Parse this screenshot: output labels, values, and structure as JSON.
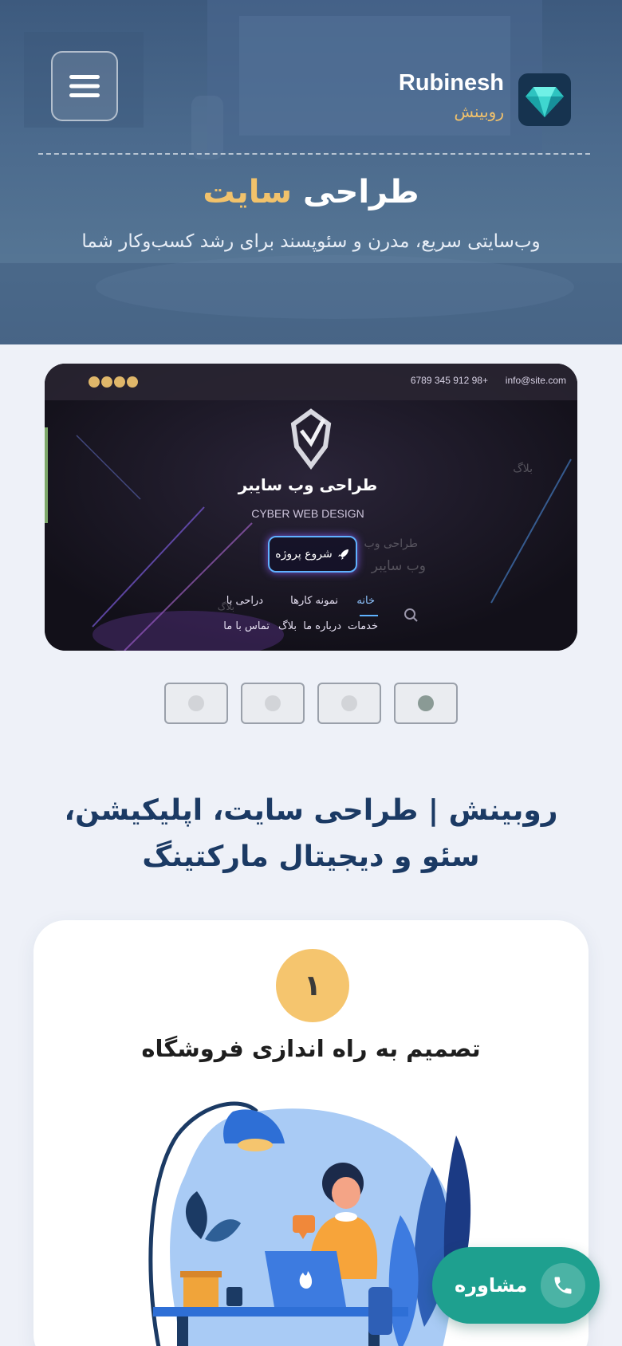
{
  "header": {
    "brand_name": "Rubinesh",
    "brand_sub": "روبینش",
    "logo_icon": "diamond-icon",
    "menu_icon": "hamburger-menu-icon"
  },
  "hero": {
    "title_main": "طراحی",
    "title_accent": "سایت",
    "description": "وب‌سایتی سریع، مدرن و سئوپسند برای رشد کسب‌وکار شما"
  },
  "slider": {
    "slide": {
      "phone": "+98 912 345 6789",
      "email": "info@site.com",
      "title": "طراحی وب سایبر",
      "subtitle": "CYBER WEB DESIGN",
      "cta": "شروع پروژه",
      "nav_row1": [
        "خانه",
        "نمونه کارها",
        "دراحی با"
      ],
      "nav_row2": [
        "خدمات",
        "درباره ما",
        "بلاگ",
        "تماس با ما"
      ],
      "ghost_1": "بلاگ",
      "ghost_2": "طراحی وب",
      "ghost_3": "وب سایبر",
      "ghost_4": "بلاگ"
    },
    "dot_count": 4,
    "active_dot": 1
  },
  "section": {
    "heading": "روبینش | طراحی سایت، اپلیکیشن، سئو و دیجیتال مارکتینگ"
  },
  "step_card": {
    "number": "۱",
    "title": "تصمیم به راه اندازی فروشگاه"
  },
  "float_button": {
    "label": "مشاوره",
    "icon": "phone-icon"
  },
  "colors": {
    "accent_gold": "#f2c26b",
    "brand_navy": "#1b3a64",
    "consult_green": "#1ea08f"
  }
}
